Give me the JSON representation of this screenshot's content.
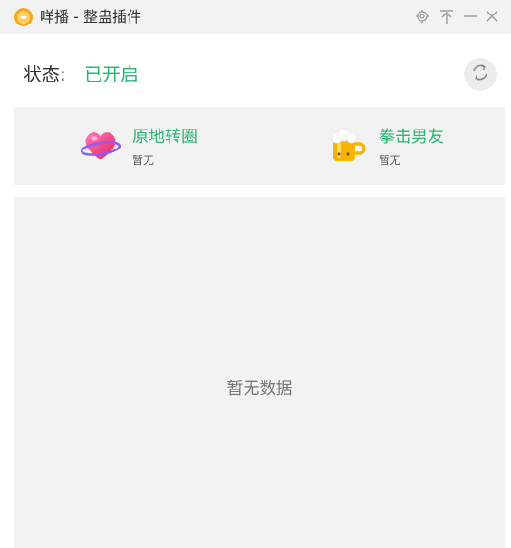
{
  "window": {
    "title": "咩播 - 整蛊插件",
    "icons": {
      "logo": "app-logo-icon",
      "settings": "gear-icon",
      "pin": "pin-top-icon",
      "minimize": "minimize-icon",
      "close": "close-icon"
    }
  },
  "status": {
    "label": "状态:",
    "value": "已开启",
    "value_color": "#2bb673",
    "refresh_icon": "refresh-icon"
  },
  "gifts": [
    {
      "name": "原地转圈",
      "sub": "暂无",
      "icon": "heart-planet-icon"
    },
    {
      "name": "拳击男友",
      "sub": "暂无",
      "icon": "beer-mug-icon"
    }
  ],
  "data_panel": {
    "empty_text": "暂无数据"
  },
  "colors": {
    "accent": "#2bb673",
    "titlebar_bg": "#f2f2f2",
    "panel_bg": "#f2f2f2",
    "logo": "#f5a623"
  }
}
